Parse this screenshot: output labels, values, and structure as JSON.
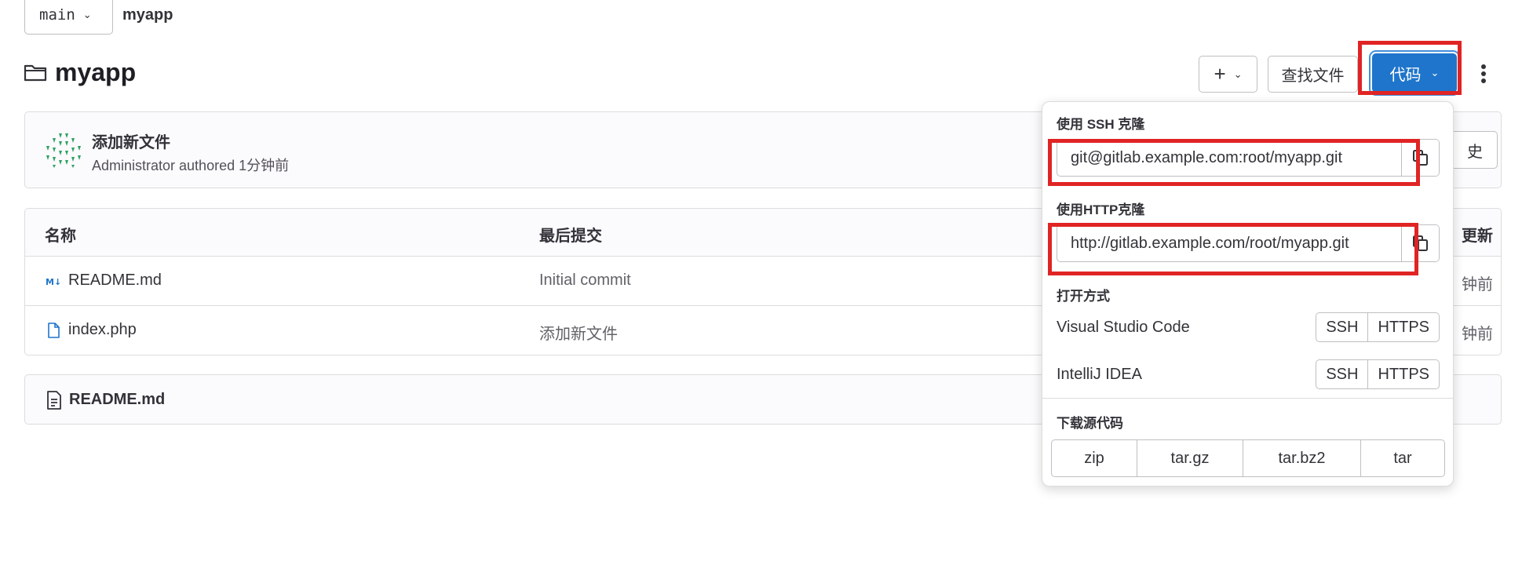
{
  "header": {
    "branch": "main",
    "breadcrumb_project": "myapp",
    "title": "myapp"
  },
  "toolbar": {
    "add_label": "+",
    "find_file_label": "查找文件",
    "code_label": "代码"
  },
  "commit": {
    "title": "添加新文件",
    "meta": "Administrator authored 1分钟前",
    "history_label": "史"
  },
  "table": {
    "columns": [
      "名称",
      "最后提交",
      "更新"
    ],
    "rows": [
      {
        "name": "README.md",
        "last_commit": "Initial commit",
        "updated": "钟前",
        "icon": "markdown-icon"
      },
      {
        "name": "index.php",
        "last_commit": "添加新文件",
        "updated": "钟前",
        "icon": "file-icon"
      }
    ]
  },
  "readme": {
    "title": "README.md"
  },
  "dropdown": {
    "ssh_label": "使用 SSH 克隆",
    "ssh_url": "git@gitlab.example.com:root/myapp.git",
    "http_label": "使用HTTP克隆",
    "http_url": "http://gitlab.example.com/root/myapp.git",
    "open_label": "打开方式",
    "ides": [
      {
        "name": "Visual Studio Code",
        "ssh": "SSH",
        "https": "HTTPS"
      },
      {
        "name": "IntelliJ IDEA",
        "ssh": "SSH",
        "https": "HTTPS"
      }
    ],
    "download_label": "下载源代码",
    "download_formats": [
      "zip",
      "tar.gz",
      "tar.bz2",
      "tar"
    ]
  },
  "colors": {
    "primary": "#1f75cb",
    "highlight": "#e02424",
    "avatar": "#2da160"
  }
}
